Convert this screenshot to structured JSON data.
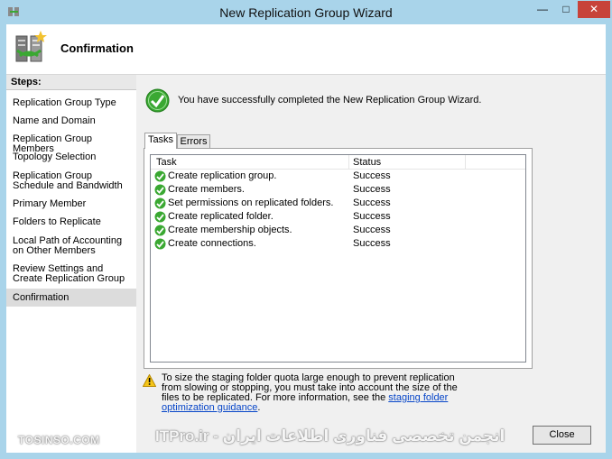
{
  "window": {
    "title": "New Replication Group Wizard"
  },
  "header": {
    "title": "Confirmation",
    "icon": "replication-group-icon"
  },
  "steps": {
    "heading": "Steps:",
    "items": [
      "Replication Group Type",
      "Name and Domain",
      "Replication Group Members",
      "Topology Selection",
      "Replication Group Schedule and Bandwidth",
      "Primary Member",
      "Folders to Replicate",
      "Local Path of Accounting on Other Members",
      "Review Settings and Create Replication Group",
      "Confirmation"
    ],
    "active_index": 9
  },
  "main": {
    "success_message": "You have successfully completed the New Replication Group Wizard.",
    "tabs": [
      {
        "label": "Tasks",
        "selected": true
      },
      {
        "label": "Errors",
        "selected": false
      }
    ],
    "table": {
      "columns": [
        "Task",
        "Status"
      ],
      "rows": [
        {
          "task": "Create replication group.",
          "status": "Success"
        },
        {
          "task": "Create members.",
          "status": "Success"
        },
        {
          "task": "Set permissions on replicated folders.",
          "status": "Success"
        },
        {
          "task": "Create replicated folder.",
          "status": "Success"
        },
        {
          "task": "Create membership objects.",
          "status": "Success"
        },
        {
          "task": "Create connections.",
          "status": "Success"
        }
      ]
    },
    "warning": {
      "text": "To size the staging folder quota large enough to prevent replication from slowing or stopping, you must take into account the size of the files to be replicated. For more information, see the ",
      "link": "staging folder optimization guidance",
      "suffix": "."
    }
  },
  "buttons": {
    "close": "Close"
  },
  "watermarks": {
    "left": "TOSINSO.COM",
    "right": "ITPro.ir - انجمن تخصصی فناوری اطلاعات ایران"
  },
  "colors": {
    "success_green": "#3aa832",
    "link_blue": "#0645c8",
    "close_red": "#c7433a",
    "frame_blue": "#a9d4ea"
  }
}
